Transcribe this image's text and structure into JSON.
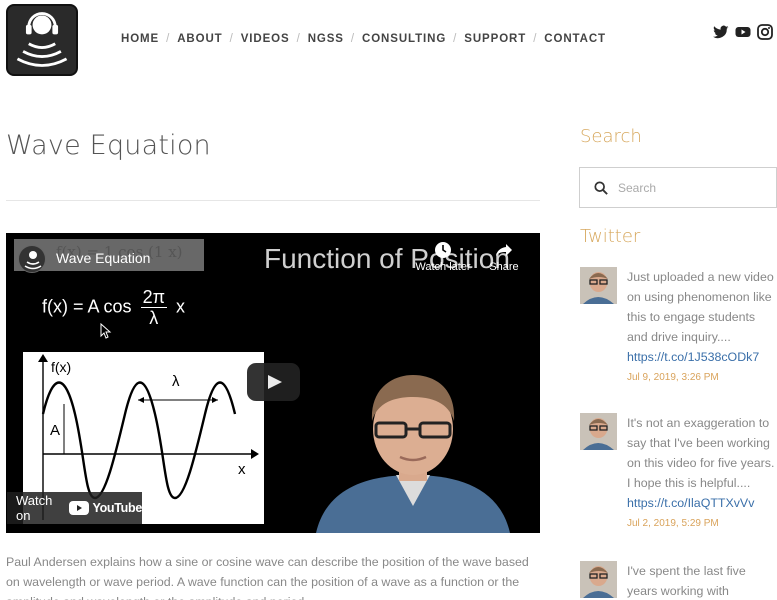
{
  "header": {
    "nav": [
      {
        "label": "HOME"
      },
      {
        "label": "ABOUT"
      },
      {
        "label": "VIDEOS"
      },
      {
        "label": "NGSS"
      },
      {
        "label": "CONSULTING"
      },
      {
        "label": "SUPPORT"
      },
      {
        "label": "CONTACT"
      }
    ],
    "separator": "/",
    "social": [
      "twitter-icon",
      "youtube-icon",
      "instagram-icon"
    ]
  },
  "page": {
    "title": "Wave Equation",
    "description": "Paul Andersen explains how a sine or cosine wave can describe the position of the wave based on wavelength or wave period.  A wave function can the position of a wave as a function or the amplitude and wavelength or the amplitude and period."
  },
  "video": {
    "title": "Wave Equation",
    "overlay_formula": "f(x) = 1 cos (1 x)",
    "slide_title": "Function of Position",
    "watch_later": "Watch later",
    "share": "Share",
    "formula_left": "f(x) = A cos",
    "formula_num": "2π",
    "formula_den": "λ",
    "formula_var": "x",
    "graph_ylabel": "f(x)",
    "graph_xlabel": "x",
    "graph_amplitude": "A",
    "graph_lambda": "λ",
    "watch_on": "Watch on",
    "youtube": "YouTube"
  },
  "sidebar": {
    "search_heading": "Search",
    "search_placeholder": "Search",
    "twitter_heading": "Twitter",
    "tweets": [
      {
        "text": "Just uploaded a new video on using phenomenon like this to engage students and drive inquiry....",
        "link": "https://t.co/1J538cODk7",
        "date": "Jul 9, 2019, 3:26 PM"
      },
      {
        "text": "It's not an exaggeration to say that I've been working on this video for five years. I hope this is helpful....",
        "link": "https://t.co/IlaQTTXvVv",
        "date": "Jul 2, 2019, 5:29 PM"
      },
      {
        "text": "I've spent the last five years working with",
        "link": "",
        "date": ""
      }
    ]
  },
  "colors": {
    "accent": "#d7a85e",
    "link": "#3a6fa9",
    "text": "#888888"
  }
}
